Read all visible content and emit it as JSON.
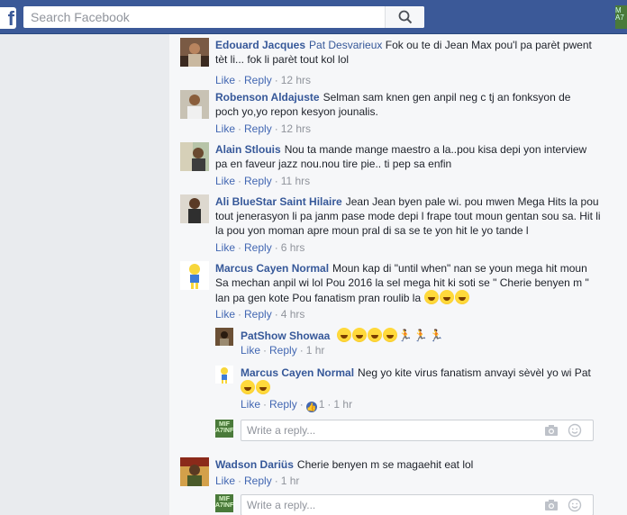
{
  "header": {
    "logo_letter": "f",
    "search_placeholder": "Search Facebook",
    "profile_badge": "M\nA7"
  },
  "comments": [
    {
      "author": "Edouard Jacques",
      "text_pre": "",
      "mention": "Pat Desvarieux",
      "text": " Fok ou te di Jean Max pou'l pa parèt pwent tèt li... fok li parèt tout kol lol",
      "like": "Like",
      "reply": "Reply",
      "time": "12 hrs"
    },
    {
      "author": "Robenson Aldajuste",
      "text": "Selman sam knen gen anpil neg c tj an fonksyon de poch yo,yo repon kesyon jounalis.",
      "like": "Like",
      "reply": "Reply",
      "time": "12 hrs"
    },
    {
      "author": "Alain Stlouis",
      "text": "Nou ta mande mange maestro a la..pou kisa depi yon interview pa en faveur jazz nou.nou tire pie.. ti pep sa enfin",
      "like": "Like",
      "reply": "Reply",
      "time": "11 hrs"
    },
    {
      "author": "Ali BlueStar Saint Hilaire",
      "text": "Jean Jean byen pale wi. pou mwen Mega Hits la pou tout jenerasyon li pa janm pase mode depi l frape tout moun gentan sou sa. Hit li la pou yon moman apre moun pral di sa se te yon hit le yo tande l",
      "like": "Like",
      "reply": "Reply",
      "time": "6 hrs"
    },
    {
      "author": "Marcus Cayen Normal",
      "text": "Moun kap di \"until when\" nan se youn mega hit moun Sa mechan anpil wi lol Pou 2016 la sel mega hit ki soti se \" Cherie benyen m \" lan pa gen kote Pou fanatism pran roulib la",
      "like": "Like",
      "reply": "Reply",
      "time": "4 hrs"
    },
    {
      "author": "PatShow Showaa",
      "text": "",
      "like": "Like",
      "reply": "Reply",
      "time": "1 hr"
    },
    {
      "author": "Marcus Cayen Normal",
      "text": "Neg yo kite virus fanatism anvayi sèvèl yo wi Pat",
      "like": "Like",
      "reply": "Reply",
      "like_count": "1",
      "time": "1 hr"
    },
    {
      "author": "Wadson Dariüs",
      "text": "Cherie benyen m se magaehit eat lol",
      "like": "Like",
      "reply": "Reply",
      "time": "1 hr"
    }
  ],
  "reply_box": {
    "placeholder": "Write a reply...",
    "avatar_label": "MIF\nA7INF"
  },
  "colors": {
    "brand": "#3b5998",
    "author": "#365899",
    "link": "#4267b2",
    "muted": "#90949c"
  },
  "icons": [
    "facebook-logo-icon",
    "search-icon",
    "camera-icon",
    "smile-icon",
    "like-thumb-icon",
    "grinning-emoji-icon",
    "runner-emoji-icon"
  ]
}
